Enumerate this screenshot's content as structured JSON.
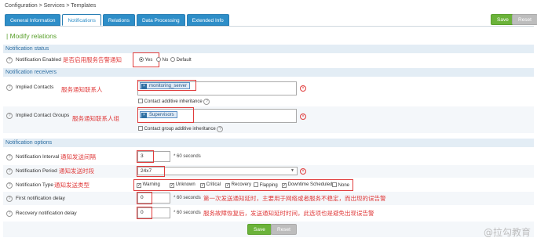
{
  "breadcrumb": "Configuration  >  Services  >  Templates",
  "tabs": [
    {
      "label": "General Information"
    },
    {
      "label": "Notifications"
    },
    {
      "label": "Relations"
    },
    {
      "label": "Data Processing"
    },
    {
      "label": "Extended Info"
    }
  ],
  "active_tab": "Notifications",
  "actions": {
    "save": "Save",
    "reset": "Reset"
  },
  "page_title": "| Modify relations",
  "sections": {
    "status": "Notification status",
    "receivers": "Notification receivers",
    "options": "Notification options"
  },
  "notification_enabled": {
    "label": "Notification Enabled",
    "note": "是否启用服务告警通知",
    "options": [
      "Yes",
      "No",
      "Default"
    ],
    "selected": "Yes"
  },
  "implied_contacts": {
    "label": "Implied Contacts",
    "note": "服务通知联系人",
    "tag": "monitoring_server",
    "additive": "Contact additive inheritance"
  },
  "implied_groups": {
    "label": "Implied Contact Groups",
    "note": "服务通知联系人组",
    "tag": "Supervisors",
    "additive": "Contact group additive inheritance"
  },
  "interval": {
    "label": "Notification Interval",
    "note": "通知发送间隔",
    "value": "3",
    "unit": "* 60 seconds"
  },
  "period": {
    "label": "Notification Period",
    "note": "通知发送时段",
    "value": "24x7"
  },
  "type": {
    "label": "Notification Type",
    "note": "通知发送类型",
    "options": [
      {
        "label": "Warning",
        "checked": true
      },
      {
        "label": "Unknown",
        "checked": true
      },
      {
        "label": "Critical",
        "checked": true
      },
      {
        "label": "Recovery",
        "checked": true
      },
      {
        "label": "Flapping",
        "checked": false
      },
      {
        "label": "Downtime Scheduled",
        "checked": true
      },
      {
        "label": "None",
        "checked": false
      }
    ]
  },
  "first_delay": {
    "label": "First notification delay",
    "value": "0",
    "unit": "* 60 seconds",
    "note": "第一次发送通知延时，主要用于网络或者服务不稳定，而出现的误告警"
  },
  "recovery_delay": {
    "label": "Recovery notification delay",
    "value": "0",
    "unit": "* 60 seconds",
    "note": "服务故障恢复后，发送通知延时时间，此选项也是避免出现误告警"
  },
  "watermark": "@拉勾教育",
  "colors": {
    "tab_blue": "#2e8ec8",
    "save_green": "#6bb33a",
    "annotation_red": "#e03c3c",
    "section_bg": "#e3edf5"
  }
}
